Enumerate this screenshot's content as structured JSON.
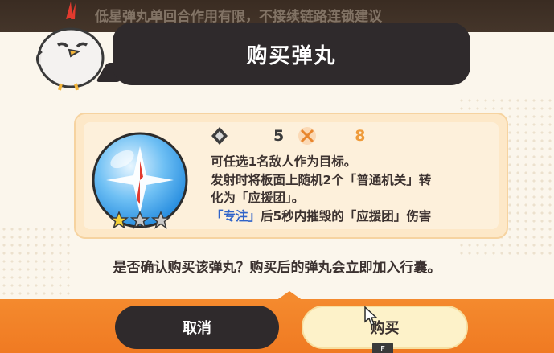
{
  "backdrop": {
    "text": "低星弹丸单回合作用有限，不接续链路连锁建议"
  },
  "dialog": {
    "title": "购买弹丸"
  },
  "item": {
    "stats": [
      {
        "icon": "shield-badge-icon",
        "value": "5"
      },
      {
        "icon": "crossed-swords-icon",
        "value": "8"
      }
    ],
    "rarity_stars": 1,
    "rarity_max": 3,
    "description": {
      "line1": "可任选1名敌人作为目标。",
      "line2": "发射时将板面上随机2个「普通机关」转",
      "line3": "化为「应援团」。",
      "line4_highlight": "「专注」",
      "line4_rest": "后5秒内摧毁的「应援团」伤害"
    }
  },
  "confirm_text": "是否确认购买该弹丸？购买后的弹丸会立即加入行囊。",
  "buttons": {
    "cancel_label": "取消",
    "buy_label": "购买",
    "buy_key_hint": "F"
  },
  "colors": {
    "title_bar": "#2f2a2c",
    "card_bg": "#fde8c8",
    "highlight": "#2f63c9",
    "accent_orange": "#ef9b3a",
    "bottom_band": "#f48a2e",
    "buy_button": "#fdf2c9"
  }
}
